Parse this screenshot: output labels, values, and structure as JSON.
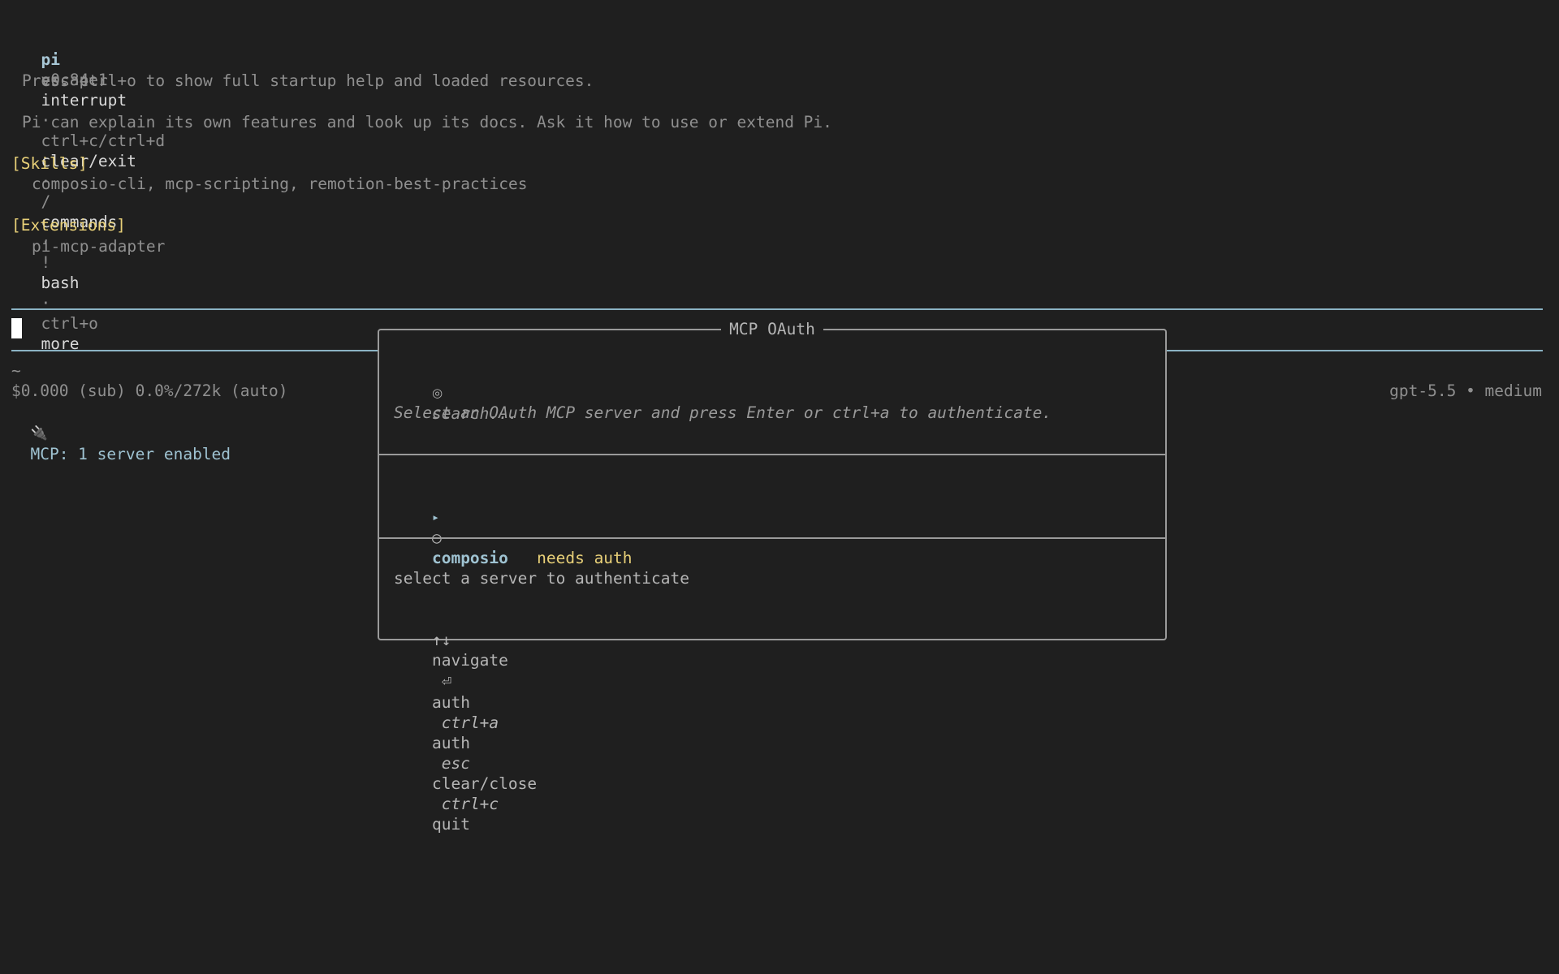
{
  "header": {
    "app_name": "pi",
    "version": "v0.84.1",
    "shortcuts": [
      {
        "key": "escape",
        "action": "interrupt"
      },
      {
        "key": "ctrl+c/ctrl+d",
        "action": "clear/exit"
      },
      {
        "key": "/",
        "action": "commands"
      },
      {
        "key": "!",
        "action": "bash"
      },
      {
        "key": "ctrl+o",
        "action": "more"
      }
    ],
    "separator": "·",
    "hint": "Press ctrl+o to show full startup help and loaded resources.",
    "about": "Pi can explain its own features and look up its docs. Ask it how to use or extend Pi."
  },
  "skills": {
    "heading": "[Skills]",
    "items": "composio-cli, mcp-scripting, remotion-best-practices"
  },
  "extensions": {
    "heading": "[Extensions]",
    "items": "pi-mcp-adapter"
  },
  "status": {
    "cwd": "~",
    "cost": "$0.000 (sub) 0.0%/272k (auto)",
    "model": "gpt-5.5 • medium",
    "mcp_icon": "🔌",
    "mcp_status": "MCP: 1 server enabled"
  },
  "modal": {
    "title": "MCP OAuth",
    "search_icon": "◎",
    "search_placeholder": "search...",
    "instruction": "Select an OAuth MCP server and press Enter or ctrl+a to authenticate.",
    "servers": [
      {
        "pointer": "▸",
        "status_icon": "○",
        "name": "composio",
        "status": "needs auth"
      }
    ],
    "detail": "select a server to authenticate",
    "keys": [
      {
        "key": "↑↓",
        "action": "navigate"
      },
      {
        "key": "⏎",
        "action": "auth"
      },
      {
        "key": "ctrl+a",
        "action": "auth"
      },
      {
        "key": "esc",
        "action": "clear/close"
      },
      {
        "key": "ctrl+c",
        "action": "quit"
      }
    ]
  }
}
